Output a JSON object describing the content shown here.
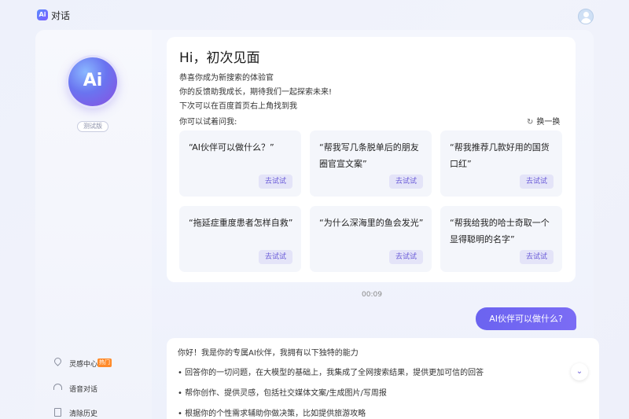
{
  "app": {
    "logo_text": "Ai",
    "title": "对话"
  },
  "sidebar": {
    "logo_text": "Ai",
    "badge": "测试版",
    "items": [
      {
        "label": "灵感中心",
        "tag": "热门",
        "icon": "location-pin-icon"
      },
      {
        "label": "语音对话",
        "icon": "headphones-icon"
      },
      {
        "label": "清除历史",
        "icon": "trash-icon"
      }
    ]
  },
  "welcome": {
    "title": "Hi，初次见面",
    "lines": [
      "恭喜你成为新搜索的体验官",
      "你的反馈助我成长，期待我们一起探索未来!",
      "下次可以在百度首页右上角找到我"
    ],
    "try_label": "你可以试着问我:",
    "refresh_label": "换一换",
    "try_button": "去试试",
    "prompts": [
      "“AI伙伴可以做什么？”",
      "“帮我写几条脱单后的朋友圈官宣文案”",
      "“帮我推荐几款好用的国货口红”",
      "“拖延症重度患者怎样自救”",
      "“为什么深海里的鱼会发光”",
      "“帮我给我的哈士奇取一个显得聪明的名字”"
    ]
  },
  "chat": {
    "timestamp": "00:09",
    "user_message": "AI伙伴可以做什么?",
    "answer_lines": [
      "你好！我是你的专属AI伙伴，我拥有以下独特的能力",
      "• 回答你的一切问题，在大模型的基础上，我集成了全网搜索结果，提供更加可信的回答",
      "• 帮你创作、提供灵感，包括社交媒体文案/生成图片/写周报",
      "• 根据你的个性需求辅助你做决策，比如提供旅游攻略"
    ]
  },
  "colors": {
    "accent": "#6b63f0",
    "hot_tag": "#ff8a2a"
  }
}
